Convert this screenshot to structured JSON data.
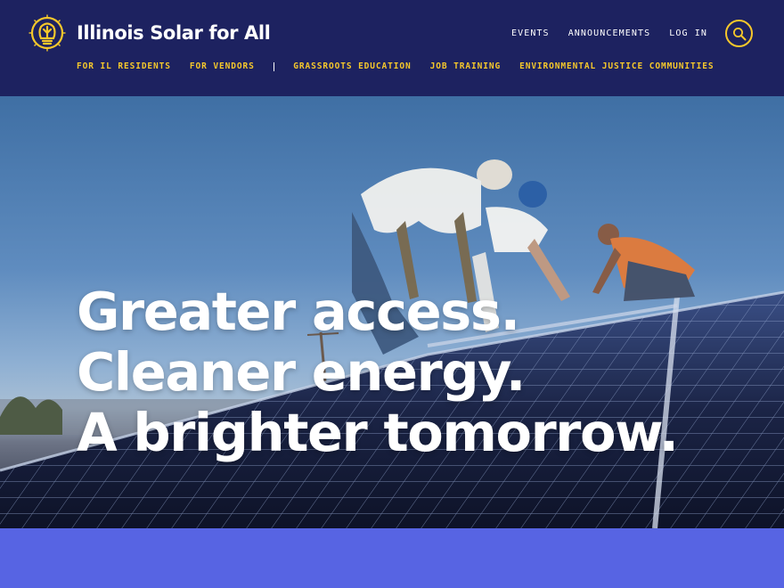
{
  "site": {
    "name": "Illinois Solar for All",
    "logo_icon": "sun-lightbulb-icon"
  },
  "utility_nav": [
    {
      "label": "EVENTS"
    },
    {
      "label": "ANNOUNCEMENTS"
    },
    {
      "label": "LOG IN"
    }
  ],
  "search": {
    "icon": "search-icon"
  },
  "main_nav": {
    "left": [
      {
        "label": "FOR IL RESIDENTS"
      },
      {
        "label": "FOR VENDORS"
      }
    ],
    "right": [
      {
        "label": "GRASSROOTS EDUCATION"
      },
      {
        "label": "JOB TRAINING"
      },
      {
        "label": "ENVIRONMENTAL JUSTICE COMMUNITIES"
      }
    ]
  },
  "hero": {
    "headline": [
      "Greater access.",
      "Cleaner energy.",
      "A brighter tomorrow."
    ]
  },
  "colors": {
    "navy": "#1d2260",
    "accent_yellow": "#f6c82b",
    "band_blue": "#5764e3"
  }
}
